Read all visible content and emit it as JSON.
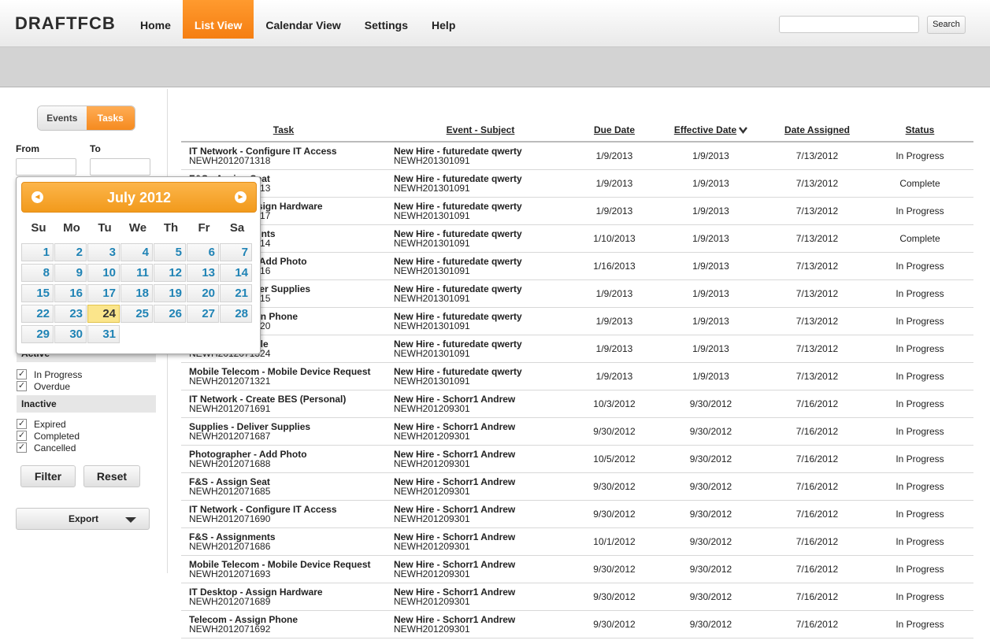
{
  "header": {
    "logo": "DRAFTFCB",
    "nav": [
      {
        "label": "Home",
        "active": false
      },
      {
        "label": "List View",
        "active": true
      },
      {
        "label": "Calendar View",
        "active": false
      },
      {
        "label": "Settings",
        "active": false
      },
      {
        "label": "Help",
        "active": false
      }
    ],
    "search_value": "",
    "search_button": "Search"
  },
  "sidebar": {
    "toggle": {
      "events": "Events",
      "tasks": "Tasks",
      "selected": "Tasks"
    },
    "from_label": "From",
    "to_label": "To",
    "from_value": "",
    "to_value": "",
    "active_heading": "Active",
    "active_items": [
      {
        "label": "In Progress",
        "checked": true
      },
      {
        "label": "Overdue",
        "checked": true
      }
    ],
    "inactive_heading": "Inactive",
    "inactive_items": [
      {
        "label": "Expired",
        "checked": true
      },
      {
        "label": "Completed",
        "checked": true
      },
      {
        "label": "Cancelled",
        "checked": true
      }
    ],
    "filter_button": "Filter",
    "reset_button": "Reset",
    "export_button": "Export"
  },
  "calendar": {
    "title": "July 2012",
    "prev": "◄",
    "next": "►",
    "weekdays": [
      "Su",
      "Mo",
      "Tu",
      "We",
      "Th",
      "Fr",
      "Sa"
    ],
    "start_weekday": 0,
    "days": 31,
    "today": 24
  },
  "table": {
    "headers": [
      "Task",
      "Event - Subject",
      "Due Date",
      "Effective Date",
      "Date Assigned",
      "Status"
    ],
    "sorted_column": "Effective Date",
    "rows": [
      {
        "task": "IT Network - Configure IT Access",
        "task_id": "NEWH2012071318",
        "event": "New Hire - futuredate qwerty",
        "event_id": "NEWH201301091",
        "due": "1/9/2013",
        "effective": "1/9/2013",
        "assigned": "7/13/2012",
        "status": "In Progress"
      },
      {
        "task": "F&S - Assign Seat",
        "task_id": "NEWH2012071313",
        "event": "New Hire - futuredate qwerty",
        "event_id": "NEWH201301091",
        "due": "1/9/2013",
        "effective": "1/9/2013",
        "assigned": "7/13/2012",
        "status": "Complete"
      },
      {
        "task": "IT Desktop - Assign Hardware",
        "task_id": "NEWH2012071317",
        "event": "New Hire - futuredate qwerty",
        "event_id": "NEWH201301091",
        "due": "1/9/2013",
        "effective": "1/9/2013",
        "assigned": "7/13/2012",
        "status": "In Progress"
      },
      {
        "task": "F&S - Assignments",
        "task_id": "NEWH2012071314",
        "event": "New Hire - futuredate qwerty",
        "event_id": "NEWH201301091",
        "due": "1/10/2013",
        "effective": "1/9/2013",
        "assigned": "7/13/2012",
        "status": "Complete"
      },
      {
        "task": "Photographer - Add Photo",
        "task_id": "NEWH2012071316",
        "event": "New Hire - futuredate qwerty",
        "event_id": "NEWH201301091",
        "due": "1/16/2013",
        "effective": "1/9/2013",
        "assigned": "7/13/2012",
        "status": "In Progress"
      },
      {
        "task": "Supplies - Deliver Supplies",
        "task_id": "NEWH2012071315",
        "event": "New Hire - futuredate qwerty",
        "event_id": "NEWH201301091",
        "due": "1/9/2013",
        "effective": "1/9/2013",
        "assigned": "7/13/2012",
        "status": "In Progress"
      },
      {
        "task": "Telecom - Assign Phone",
        "task_id": "NEWH2012071320",
        "event": "New Hire - futuredate qwerty",
        "event_id": "NEWH201301091",
        "due": "1/9/2013",
        "effective": "1/9/2013",
        "assigned": "7/13/2012",
        "status": "In Progress"
      },
      {
        "task": "Directory - Profile",
        "task_id": "NEWH2012071324",
        "event": "New Hire - futuredate qwerty",
        "event_id": "NEWH201301091",
        "due": "1/9/2013",
        "effective": "1/9/2013",
        "assigned": "7/13/2012",
        "status": "In Progress"
      },
      {
        "task": "Mobile Telecom - Mobile Device Request",
        "task_id": "NEWH2012071321",
        "event": "New Hire - futuredate qwerty",
        "event_id": "NEWH201301091",
        "due": "1/9/2013",
        "effective": "1/9/2013",
        "assigned": "7/13/2012",
        "status": "In Progress"
      },
      {
        "task": "IT Network - Create BES (Personal)",
        "task_id": "NEWH2012071691",
        "event": "New Hire - Schorr1 Andrew",
        "event_id": "NEWH201209301",
        "due": "10/3/2012",
        "effective": "9/30/2012",
        "assigned": "7/16/2012",
        "status": "In Progress"
      },
      {
        "task": "Supplies - Deliver Supplies",
        "task_id": "NEWH2012071687",
        "event": "New Hire - Schorr1 Andrew",
        "event_id": "NEWH201209301",
        "due": "9/30/2012",
        "effective": "9/30/2012",
        "assigned": "7/16/2012",
        "status": "In Progress"
      },
      {
        "task": "Photographer - Add Photo",
        "task_id": "NEWH2012071688",
        "event": "New Hire - Schorr1 Andrew",
        "event_id": "NEWH201209301",
        "due": "10/5/2012",
        "effective": "9/30/2012",
        "assigned": "7/16/2012",
        "status": "In Progress"
      },
      {
        "task": "F&S - Assign Seat",
        "task_id": "NEWH2012071685",
        "event": "New Hire - Schorr1 Andrew",
        "event_id": "NEWH201209301",
        "due": "9/30/2012",
        "effective": "9/30/2012",
        "assigned": "7/16/2012",
        "status": "In Progress"
      },
      {
        "task": "IT Network - Configure IT Access",
        "task_id": "NEWH2012071690",
        "event": "New Hire - Schorr1 Andrew",
        "event_id": "NEWH201209301",
        "due": "9/30/2012",
        "effective": "9/30/2012",
        "assigned": "7/16/2012",
        "status": "In Progress"
      },
      {
        "task": "F&S - Assignments",
        "task_id": "NEWH2012071686",
        "event": "New Hire - Schorr1 Andrew",
        "event_id": "NEWH201209301",
        "due": "10/1/2012",
        "effective": "9/30/2012",
        "assigned": "7/16/2012",
        "status": "In Progress"
      },
      {
        "task": "Mobile Telecom - Mobile Device Request",
        "task_id": "NEWH2012071693",
        "event": "New Hire - Schorr1 Andrew",
        "event_id": "NEWH201209301",
        "due": "9/30/2012",
        "effective": "9/30/2012",
        "assigned": "7/16/2012",
        "status": "In Progress"
      },
      {
        "task": "IT Desktop - Assign Hardware",
        "task_id": "NEWH2012071689",
        "event": "New Hire - Schorr1 Andrew",
        "event_id": "NEWH201209301",
        "due": "9/30/2012",
        "effective": "9/30/2012",
        "assigned": "7/16/2012",
        "status": "In Progress"
      },
      {
        "task": "Telecom - Assign Phone",
        "task_id": "NEWH2012071692",
        "event": "New Hire - Schorr1 Andrew",
        "event_id": "NEWH201209301",
        "due": "9/30/2012",
        "effective": "9/30/2012",
        "assigned": "7/16/2012",
        "status": "In Progress"
      }
    ]
  },
  "colors": {
    "accent": "#f58a1f",
    "link": "#1f83b5"
  }
}
